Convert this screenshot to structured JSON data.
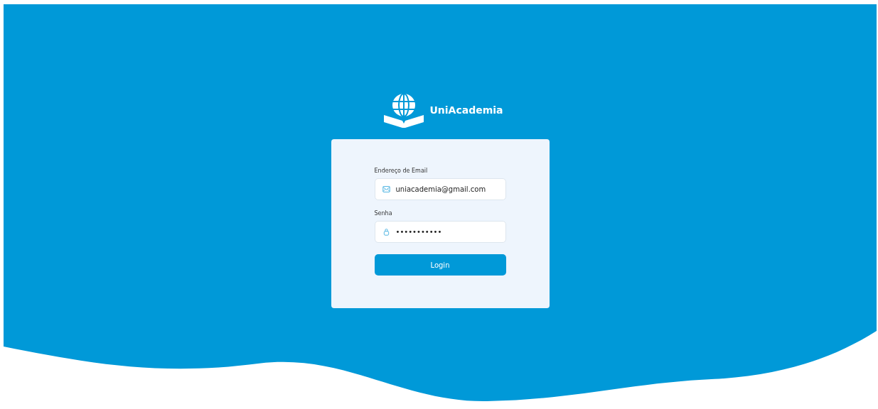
{
  "brand": {
    "name": "UniAcademia"
  },
  "form": {
    "email": {
      "label": "Endereço de Email",
      "value": "uniacademia@gmail.com"
    },
    "password": {
      "label": "Senha",
      "value": "•••••••••••"
    },
    "submit": "Login"
  }
}
